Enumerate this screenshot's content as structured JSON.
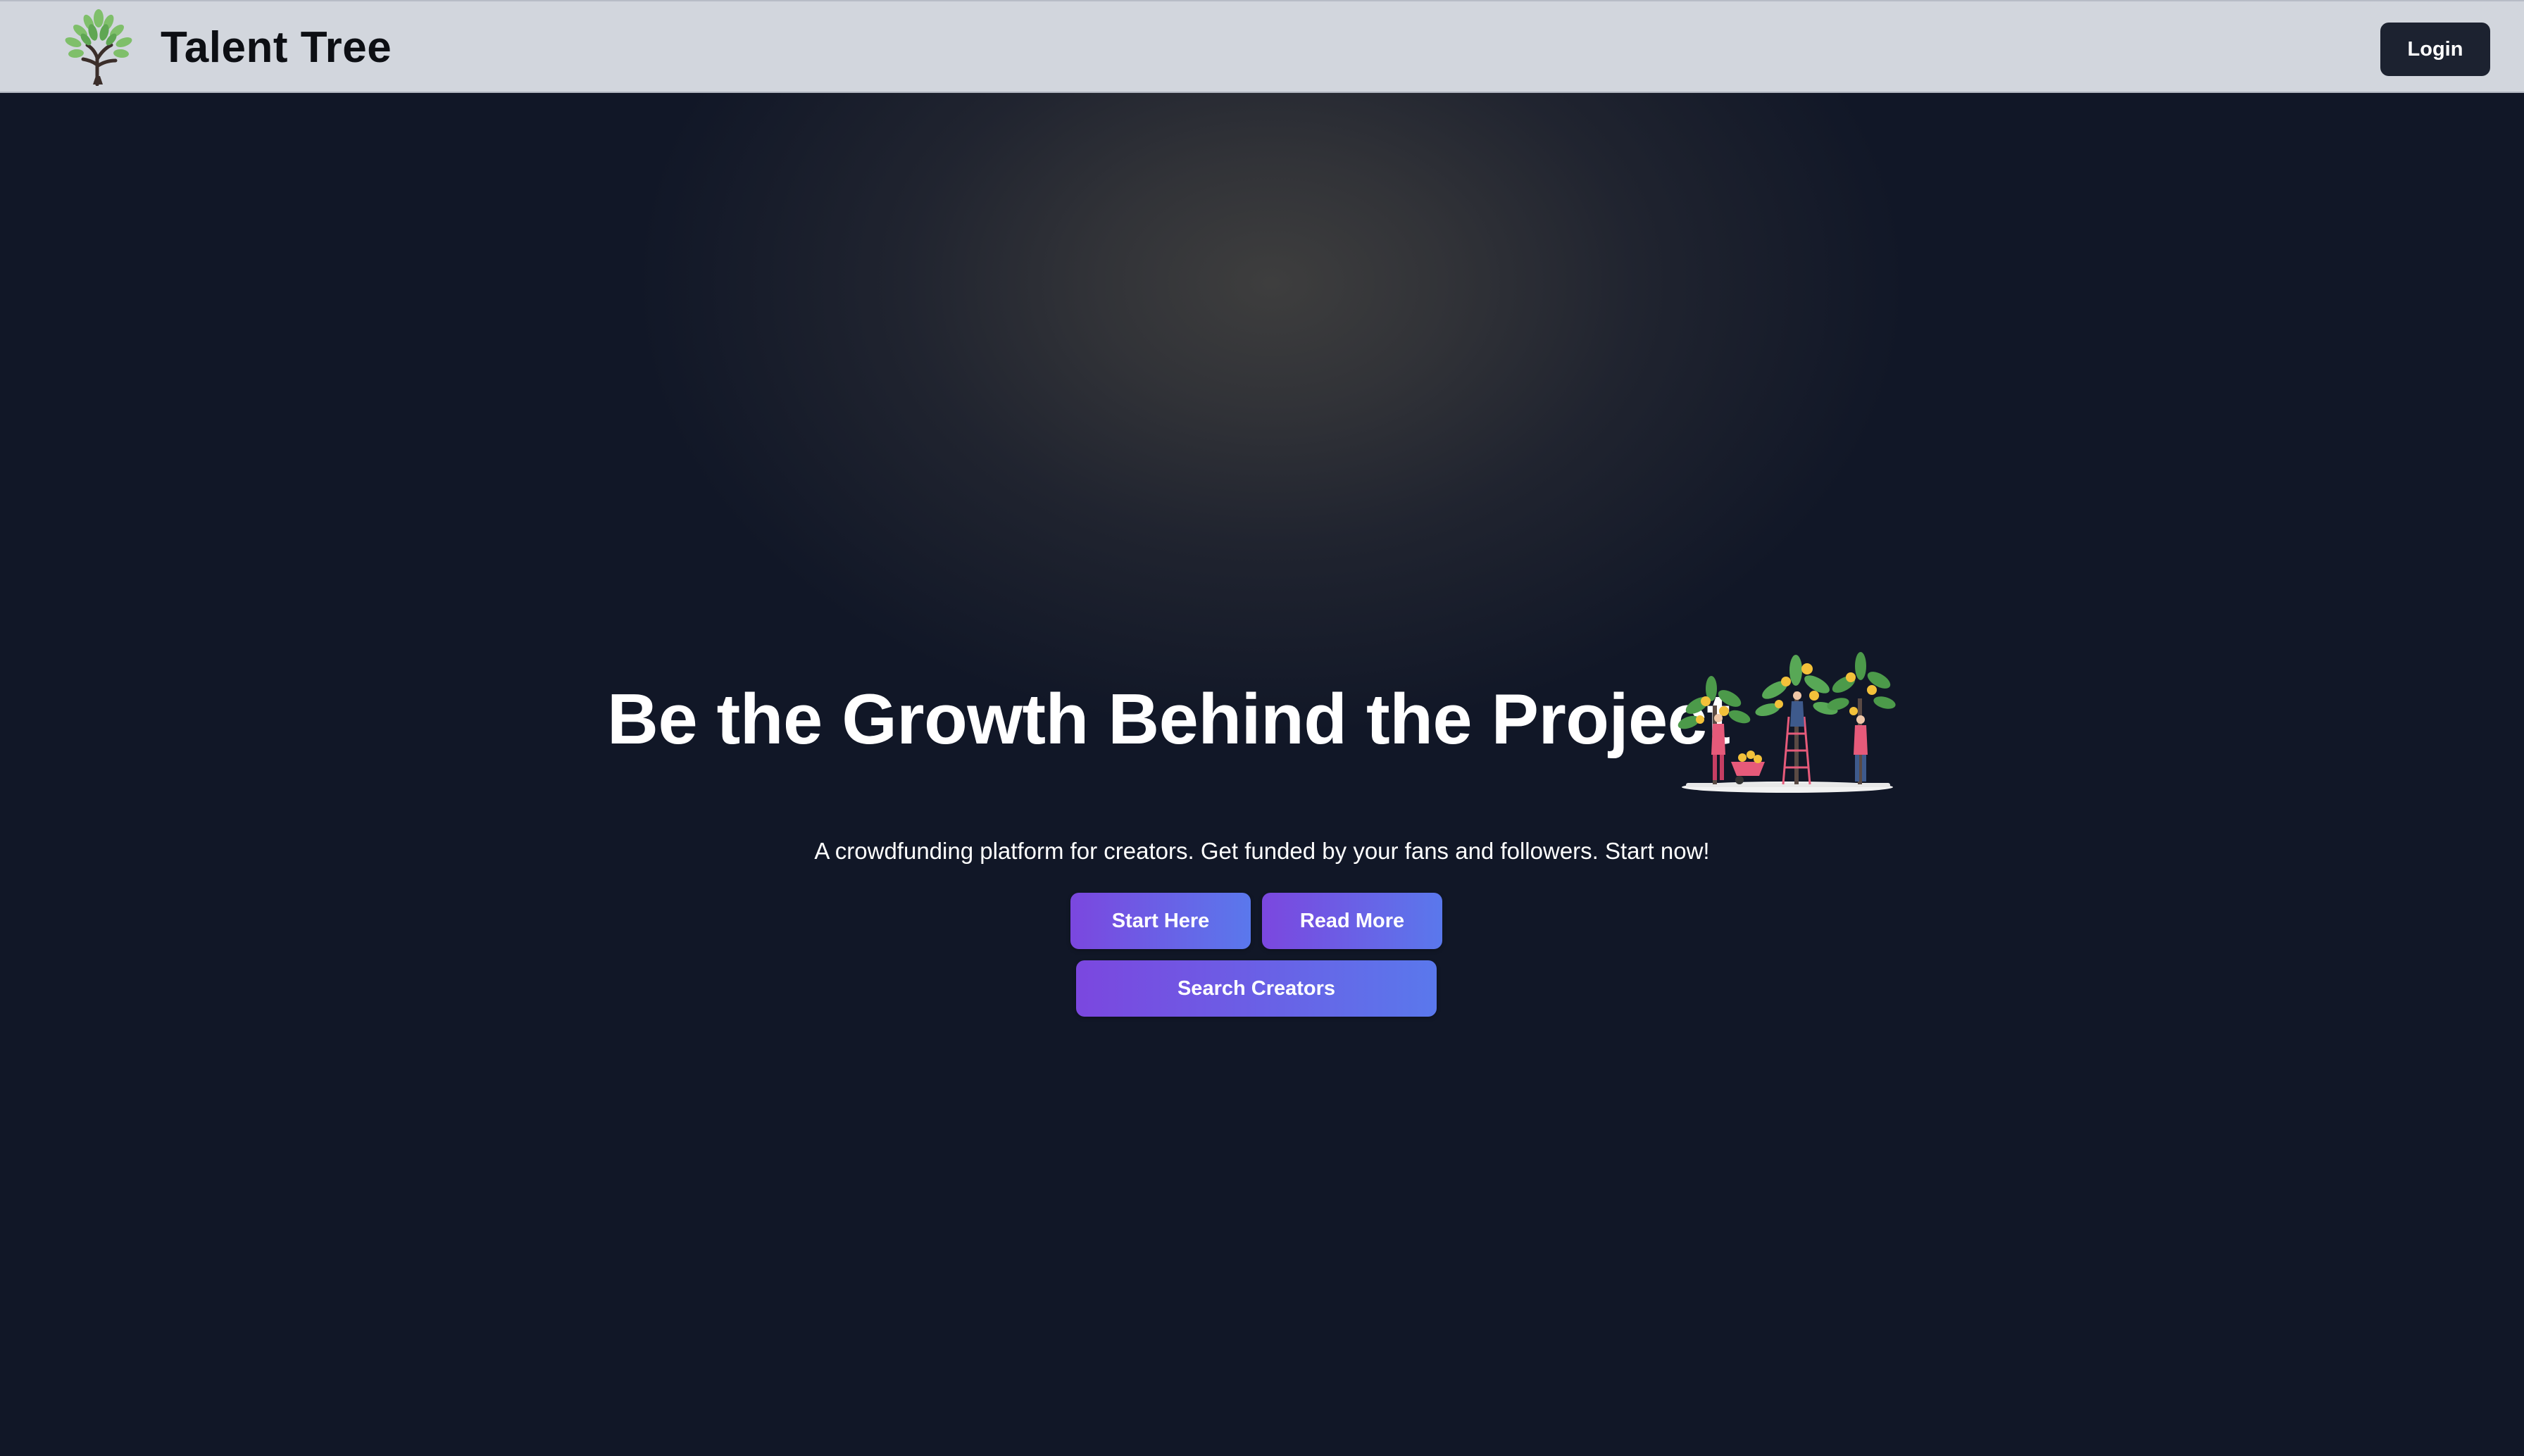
{
  "header": {
    "brand_name": "Talent Tree",
    "logo_icon": "tree-logo-icon",
    "login_label": "Login"
  },
  "hero": {
    "headline": "Be the Growth Behind the Project",
    "illustration_icon": "people-harvesting-trees-illustration",
    "tagline": "A crowdfunding platform for creators. Get funded by your fans and followers. Start now!",
    "buttons": {
      "start_here": "Start Here",
      "read_more": "Read More",
      "search_creators": "Search Creators"
    }
  },
  "colors": {
    "navbar_bg": "#d2d6dd",
    "page_bg": "#111727",
    "login_bg": "#1c2230",
    "cta_gradient_start": "#7b47df",
    "cta_gradient_end": "#5a78ec",
    "text_light": "#ffffff",
    "text_dark": "#0d0f14"
  }
}
